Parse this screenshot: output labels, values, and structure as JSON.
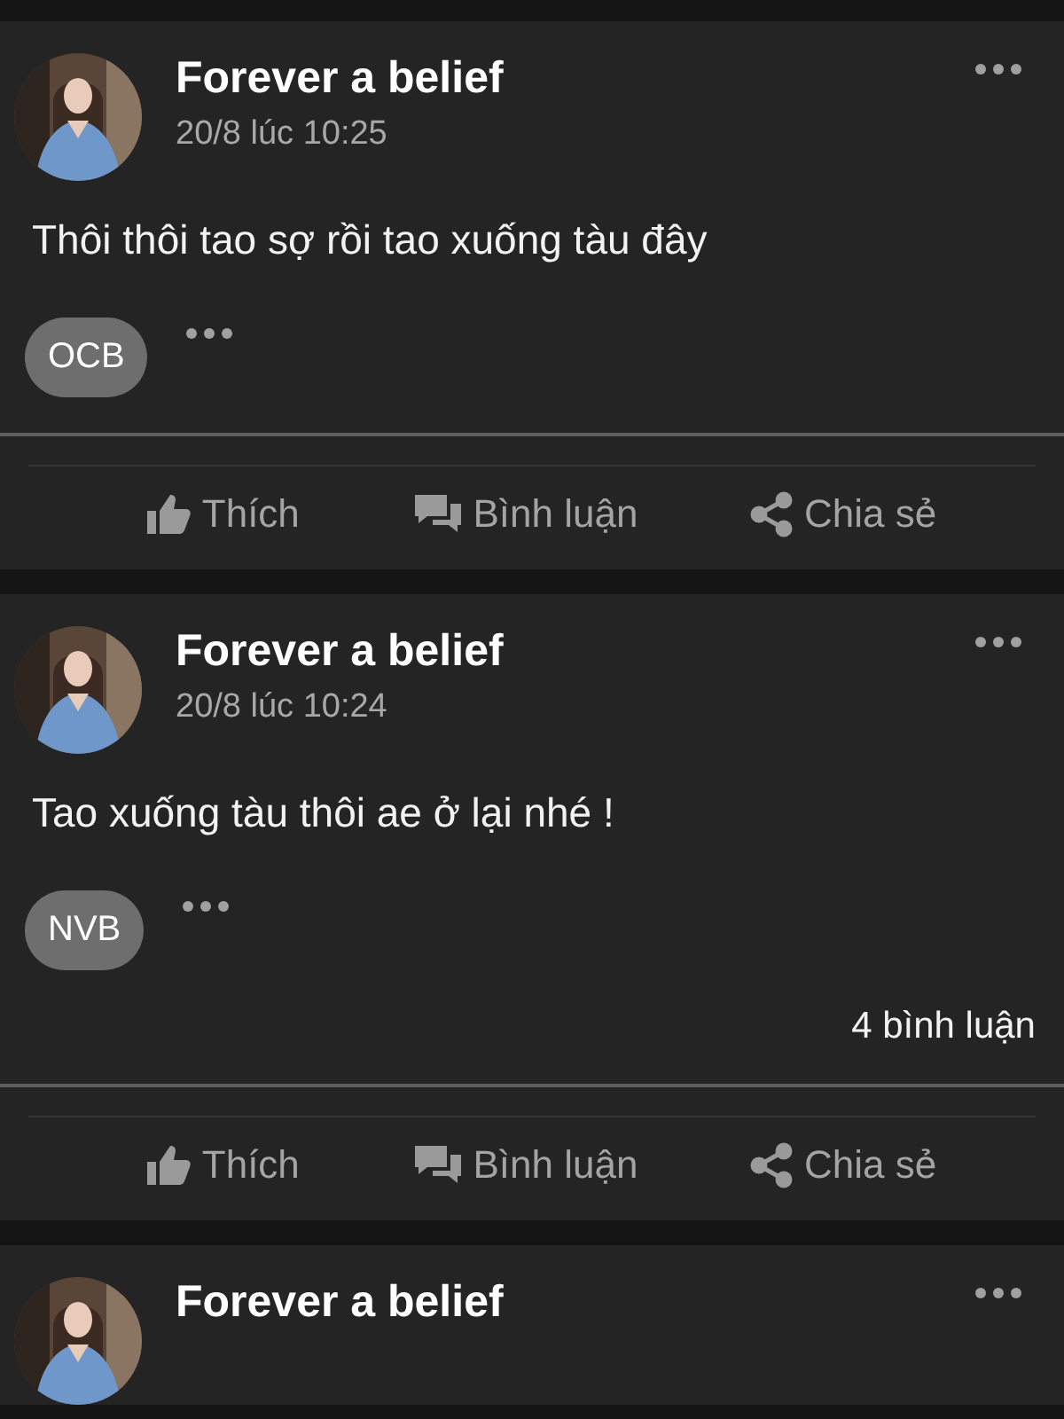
{
  "posts": [
    {
      "author": "Forever a belief",
      "time": "20/8 lúc 10:25",
      "text": "Thôi thôi tao sợ rồi tao xuống tàu đây",
      "reaction": "OCB",
      "actions": [
        "Thích",
        "Bình luận",
        "Chia sẻ"
      ]
    },
    {
      "author": "Forever a belief",
      "time": "20/8 lúc 10:24",
      "text": "Tao xuống tàu thôi ae ở lại nhé !",
      "reaction": "NVB",
      "comment_count": "4 bình luận",
      "actions": [
        "Thích",
        "Bình luận",
        "Chia sẻ"
      ]
    },
    {
      "author": "Forever a belief"
    }
  ]
}
